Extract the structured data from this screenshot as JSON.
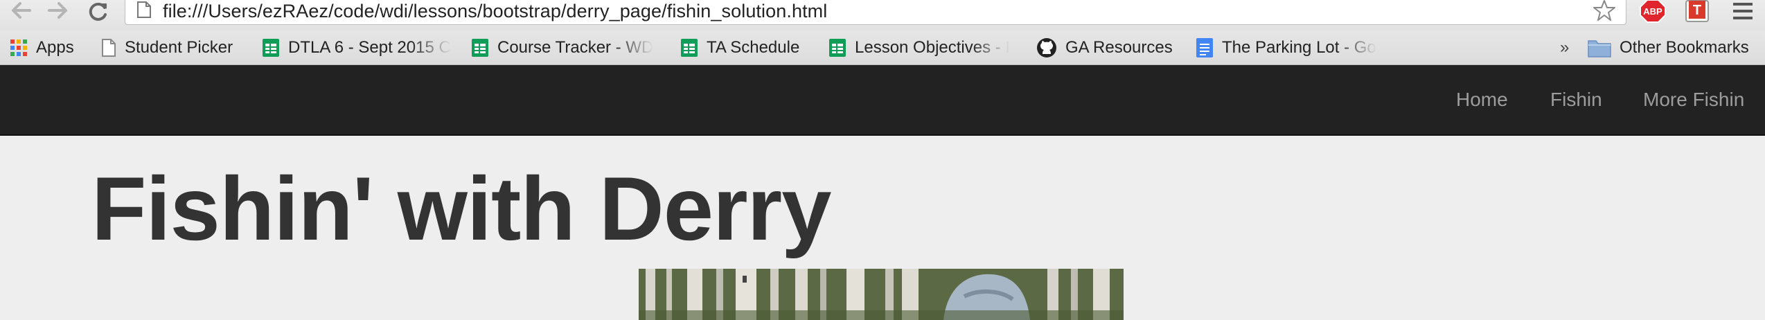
{
  "browser": {
    "url": "file:///Users/ezRAez/code/wdi/lessons/bootstrap/derry_page/fishin_solution.html",
    "extensions": {
      "abp_label": "ABP",
      "t_label": "T"
    },
    "bookmarks": [
      {
        "label": "Apps",
        "icon": "apps-grid-icon"
      },
      {
        "label": "Student Picker",
        "icon": "page-icon"
      },
      {
        "label": "DTLA 6 - Sept 2015 C",
        "icon": "sheets-icon"
      },
      {
        "label": "Course Tracker - WD",
        "icon": "sheets-icon"
      },
      {
        "label": "TA Schedule",
        "icon": "sheets-icon"
      },
      {
        "label": "Lesson Objectives - I",
        "icon": "sheets-icon"
      },
      {
        "label": "GA Resources",
        "icon": "github-icon"
      },
      {
        "label": "The Parking Lot - Go",
        "icon": "docs-icon"
      }
    ],
    "more_bookmarks": "»",
    "other_bookmarks": "Other Bookmarks"
  },
  "navbar": {
    "links": [
      {
        "label": "Home"
      },
      {
        "label": "Fishin"
      },
      {
        "label": "More Fishin"
      }
    ]
  },
  "page": {
    "title": "Fishin' with Derry"
  }
}
